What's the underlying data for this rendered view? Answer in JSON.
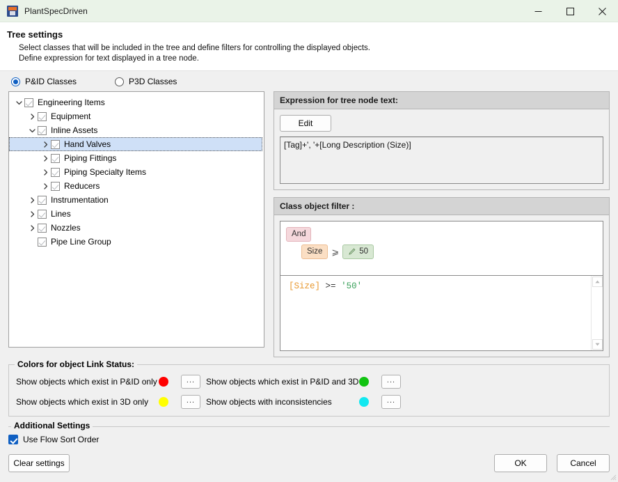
{
  "window": {
    "title": "PlantSpecDriven",
    "icon": "plant-app-icon",
    "controls": {
      "minimize": "minimize-icon",
      "maximize": "maximize-icon",
      "close": "close-icon"
    }
  },
  "header": {
    "title": "Tree settings",
    "line1": "Select classes that will be included in the tree and define filters for controlling the displayed objects.",
    "line2": "Define expression for text displayed in a tree node."
  },
  "class_mode": {
    "options": [
      {
        "label": "P&ID Classes",
        "selected": true
      },
      {
        "label": "P3D Classes",
        "selected": false
      }
    ]
  },
  "tree": {
    "nodes": [
      {
        "label": "Engineering Items",
        "depth": 0,
        "arrow": "expanded",
        "checked": true,
        "selected": false
      },
      {
        "label": "Equipment",
        "depth": 1,
        "arrow": "collapsed",
        "checked": true,
        "selected": false
      },
      {
        "label": "Inline Assets",
        "depth": 1,
        "arrow": "expanded",
        "checked": true,
        "selected": false
      },
      {
        "label": "Hand Valves",
        "depth": 2,
        "arrow": "collapsed",
        "checked": true,
        "selected": true
      },
      {
        "label": "Piping Fittings",
        "depth": 2,
        "arrow": "collapsed",
        "checked": true,
        "selected": false
      },
      {
        "label": "Piping Specialty Items",
        "depth": 2,
        "arrow": "collapsed",
        "checked": true,
        "selected": false
      },
      {
        "label": "Reducers",
        "depth": 2,
        "arrow": "collapsed",
        "checked": true,
        "selected": false
      },
      {
        "label": "Instrumentation",
        "depth": 1,
        "arrow": "collapsed",
        "checked": true,
        "selected": false
      },
      {
        "label": "Lines",
        "depth": 1,
        "arrow": "collapsed",
        "checked": true,
        "selected": false
      },
      {
        "label": "Nozzles",
        "depth": 1,
        "arrow": "collapsed",
        "checked": true,
        "selected": false
      },
      {
        "label": "Pipe Line Group",
        "depth": 1,
        "arrow": "none",
        "checked": true,
        "selected": false
      }
    ]
  },
  "expression": {
    "group_title": "Expression for tree node text:",
    "edit_label": "Edit",
    "value": "[Tag]+', '+[Long Description (Size)]"
  },
  "filter": {
    "group_title": "Class object filter :",
    "builder": {
      "logic": "And",
      "conditions": [
        {
          "field": "Size",
          "operator": "⩾",
          "value": "50",
          "edit_icon": "pencil-icon"
        }
      ]
    },
    "code": {
      "field": "[Size]",
      "operator": ">=",
      "value": "'50'"
    },
    "scroll_up": "scroll-up-arrow",
    "scroll_down": "scroll-down-arrow"
  },
  "colors": {
    "legend": "Colors for object Link Status:",
    "browse_label": "...",
    "items": [
      {
        "label": "Show objects which exist in P&ID only",
        "color": "#ff0000"
      },
      {
        "label": "Show objects which exist in P&ID and 3D",
        "color": "#12c312"
      },
      {
        "label": "Show objects which exist in 3D only",
        "color": "#ffff00"
      },
      {
        "label": "Show objects with inconsistencies",
        "color": "#12e8f0"
      }
    ]
  },
  "additional": {
    "legend": "Additional Settings",
    "flow_sort": {
      "label": "Use Flow Sort Order",
      "checked": true
    }
  },
  "footer": {
    "clear": "Clear settings",
    "ok": "OK",
    "cancel": "Cancel"
  }
}
